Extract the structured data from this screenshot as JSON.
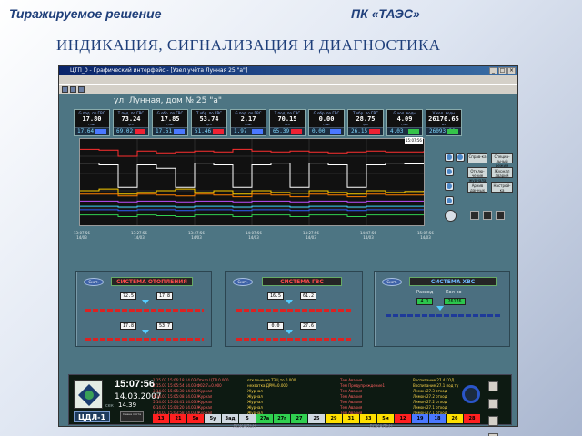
{
  "slide": {
    "header_left": "Тиражируемое решение",
    "header_right": "ПК «ТАЭС»",
    "title": "ИНДИКАЦИЯ, СИГНАЛИЗАЦИЯ И ДИАГНОСТИКА"
  },
  "window": {
    "title": "ЦТП_0 - Графический интерфейс - [Узел учёта Лунная 25 \"а\"]",
    "min": "_",
    "max": "□",
    "close": "×"
  },
  "address": "ул. Лунная, дом № 25 \"а\"",
  "tiles": [
    {
      "label": "G под. по ГВС",
      "value": "17.80",
      "unit": "т/час",
      "sub": "17.64",
      "color": "#4a78ff"
    },
    {
      "label": "T под. по ГВС",
      "value": "73.24",
      "unit": "гр.С",
      "sub": "69.02",
      "color": "#e23"
    },
    {
      "label": "G обр. по ГВС",
      "value": "17.85",
      "unit": "т/час",
      "sub": "17.51",
      "color": "#4a78ff"
    },
    {
      "label": "T обр. по ГВС",
      "value": "53.74",
      "unit": "гр.С",
      "sub": "51.46",
      "color": "#e23"
    },
    {
      "label": "G под. по ГВС",
      "value": "2.17",
      "unit": "т/час",
      "sub": "1.97",
      "color": "#4a78ff"
    },
    {
      "label": "T под. по ГВС",
      "value": "70.15",
      "unit": "гр.С",
      "sub": "65.39",
      "color": "#e23"
    },
    {
      "label": "G обр. по ГВС",
      "value": "0.00",
      "unit": "т/час",
      "sub": "0.00",
      "color": "#4a78ff"
    },
    {
      "label": "T обр. по ГВС",
      "value": "28.75",
      "unit": "гр.С",
      "sub": "26.15",
      "color": "#e23"
    },
    {
      "label": "G хол. воды",
      "value": "4.09",
      "unit": "т/час",
      "sub": "4.03",
      "color": "#35c44a"
    },
    {
      "label": "V хол. воды",
      "value": "26176.65",
      "unit": "м3",
      "sub": "26093.21",
      "color": "#35c44a"
    }
  ],
  "chart_clock": "15:07:56",
  "chart_data": {
    "type": "line",
    "x": [
      "13:07:56",
      "13:27:56",
      "13:47:56",
      "14:07:56",
      "14:27:56",
      "14:47:56",
      "15:07:56"
    ],
    "series": [
      {
        "color": "#ff3030",
        "values": [
          88,
          87,
          80,
          86,
          84,
          85,
          86,
          85,
          88,
          86,
          85,
          86,
          85,
          84,
          85,
          86,
          85,
          85,
          86
        ]
      },
      {
        "color": "#ffffff",
        "values": [
          72,
          70,
          44,
          70,
          66,
          44,
          72,
          70,
          44,
          70,
          72,
          44,
          72,
          70,
          44,
          70,
          72,
          71,
          72
        ]
      },
      {
        "color": "#ffd000",
        "values": [
          40,
          42,
          36,
          38,
          40,
          42,
          38,
          40,
          36,
          40,
          38,
          37,
          40,
          38,
          36,
          40,
          38,
          39,
          40
        ]
      },
      {
        "color": "#ff7f00",
        "values": [
          36,
          36,
          34,
          36,
          35,
          34,
          36,
          35,
          33,
          36,
          35,
          33,
          36,
          35,
          33,
          36,
          35,
          35,
          36
        ]
      },
      {
        "color": "#c050ff",
        "values": [
          28,
          28,
          27,
          28,
          28,
          27,
          28,
          28,
          27,
          28,
          28,
          27,
          28,
          28,
          27,
          28,
          28,
          28,
          28
        ]
      },
      {
        "color": "#40d8ff",
        "values": [
          22,
          22,
          21,
          22,
          22,
          21,
          22,
          22,
          21,
          22,
          22,
          21,
          22,
          22,
          21,
          22,
          22,
          22,
          22
        ]
      },
      {
        "color": "#3060ff",
        "values": [
          18,
          18,
          17,
          18,
          18,
          17,
          18,
          18,
          17,
          18,
          18,
          17,
          18,
          18,
          17,
          18,
          18,
          18,
          18
        ]
      },
      {
        "color": "#30d050",
        "values": [
          12,
          12,
          10,
          12,
          11,
          10,
          12,
          12,
          10,
          12,
          12,
          10,
          12,
          12,
          10,
          12,
          12,
          12,
          12
        ]
      }
    ],
    "ylim": [
      0,
      100
    ],
    "grid": true
  },
  "time_ticks": [
    {
      "time": "13:07:56",
      "date": "14/03"
    },
    {
      "time": "13:27:56",
      "date": "14/03"
    },
    {
      "time": "13:47:56",
      "date": "14/03"
    },
    {
      "time": "14:07:56",
      "date": "14/03"
    },
    {
      "time": "14:27:56",
      "date": "14/03"
    },
    {
      "time": "14:47:56",
      "date": "14/03"
    },
    {
      "time": "15:07:56",
      "date": "14/03"
    }
  ],
  "controls": {
    "btn1": "Справ-ка",
    "btn2": "Специа-льный режим",
    "btn3": "Отклю-чение журнала",
    "btn4": "Журнал аварий",
    "btn5": "Архив данных",
    "btn6": "Настрой-ка"
  },
  "panels": {
    "heating": {
      "sym": "Сист.",
      "title": "СИСТЕМА ОТОПЛЕНИЯ",
      "top_l": "72.5",
      "top_r": "17.8",
      "bot_l": "17.8",
      "bot_r": "53.7"
    },
    "dhw": {
      "sym": "Сист.",
      "title": "СИСТЕМА ГВС",
      "top_l": "16.5",
      "top_r": "61.2",
      "bot_l": "0.0",
      "bot_r": "27.6"
    },
    "cold": {
      "sym": "Сист.",
      "title": "СИСТЕМА ХВС",
      "lbl_l": "Расход",
      "lbl_r": "Кол-во",
      "val_l": "4.1",
      "val_r": "26176"
    }
  },
  "bottom": {
    "time": "15:07:56",
    "date": "14.03.2007",
    "small_lbl": "сек",
    "small_val": "14.39",
    "station": "ЦДЛ-1",
    "small_btn": "Смена листа",
    "events1": [
      "1 15.03 15:06:18 14.03 Отказ ЦТП 0.000",
      "2 15.03 15:05:54 14.03 Ф02:7=0.000",
      "3 14.03 15:05:30 14.03 Журнал",
      "4 14.03 15:05:08 14.03 Журнал",
      "5 14.03 15:04:41 14.03 Журнал",
      "6 14.03 15:04:20 14.03 Журнал",
      "7 14.03 15:03:58 14.03 Журнал"
    ],
    "events2": [
      "отклонение ТЭЦ то 0.000",
      "нехватка ДРМ=0.000",
      "Журнал",
      "Журнал",
      "Журнал",
      "Журнал",
      "Журнал"
    ],
    "events3": [
      "Тем Авария",
      "Тем Предупреждение1",
      "Тем Авария",
      "Тем Авария",
      "Тем Авария",
      "Тем Авария",
      "Тем Авария"
    ],
    "events4": [
      "Воспитание 27.4 ГОД",
      "Воспитание 27.1 под ту",
      "Лимон 27.3 отход",
      "Лимон 27.2 отход",
      "Лимон 27.2 отход",
      "Лимон 27.1 отход",
      "Лимон 27.1 отход"
    ],
    "nums": [
      {
        "n": "13",
        "c": "#ff2020"
      },
      {
        "n": "21",
        "c": "#ff2020"
      },
      {
        "n": "5в",
        "c": "#ff2020"
      },
      {
        "n": "5у",
        "c": "#cfd8e0"
      },
      {
        "n": "Зад",
        "c": "#cfd8e0"
      },
      {
        "n": "5",
        "c": "#cfd8e0"
      },
      {
        "n": "27а",
        "c": "#30d050"
      },
      {
        "n": "27г",
        "c": "#30d050"
      },
      {
        "n": "27",
        "c": "#30d050"
      },
      {
        "n": "25",
        "c": "#cfd8e0"
      },
      {
        "n": "29",
        "c": "#ffe000"
      },
      {
        "n": "31",
        "c": "#ffe000"
      },
      {
        "n": "33",
        "c": "#ffe000"
      },
      {
        "n": "5м",
        "c": "#ffe000"
      },
      {
        "n": "12",
        "c": "#ff2020"
      },
      {
        "n": "19",
        "c": "#4a78ff"
      },
      {
        "n": "18",
        "c": "#4a78ff"
      },
      {
        "n": "26",
        "c": "#ffe000"
      },
      {
        "n": "28",
        "c": "#ff2020"
      }
    ],
    "nav1": "ЛОКАЛЬН",
    "nav2": "ЛОКАЛЬН"
  }
}
